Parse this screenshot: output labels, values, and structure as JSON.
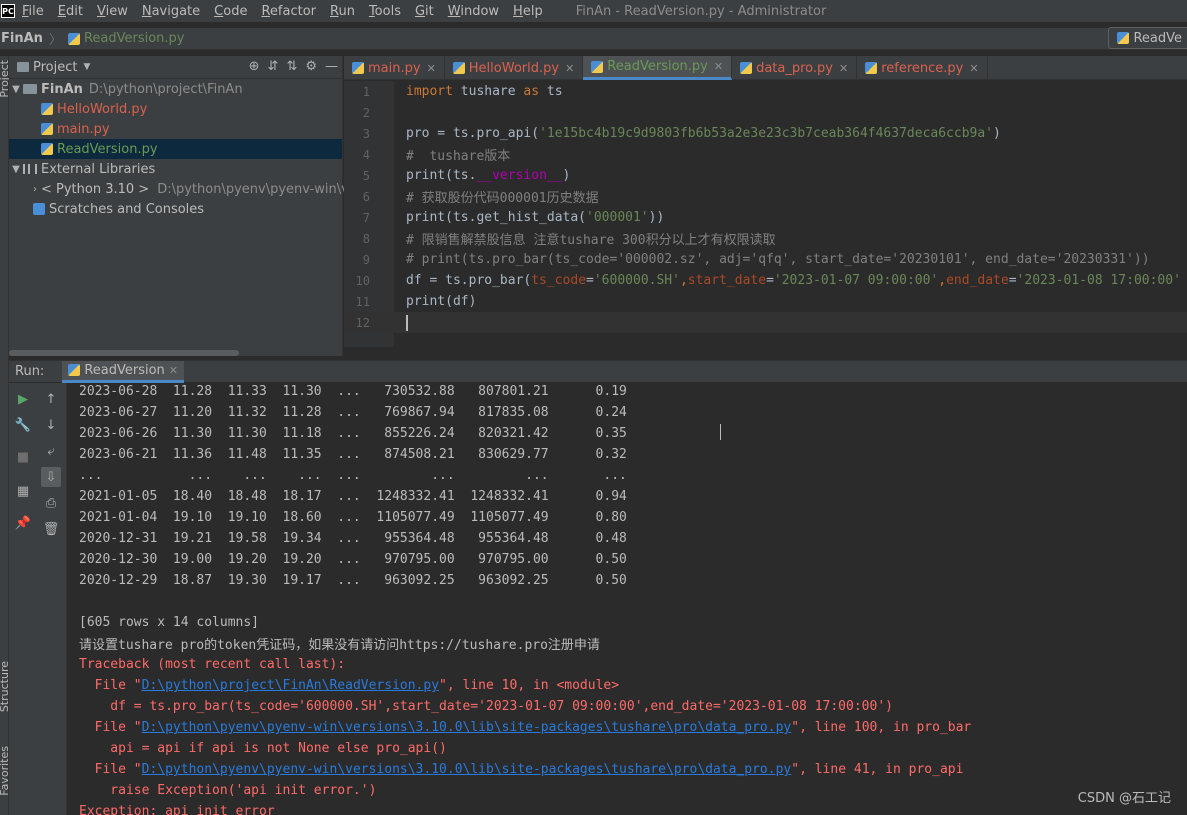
{
  "menubar": {
    "items": [
      "File",
      "Edit",
      "View",
      "Navigate",
      "Code",
      "Refactor",
      "Run",
      "Tools",
      "Git",
      "Window",
      "Help"
    ],
    "window_title": "FinAn - ReadVersion.py - Administrator",
    "logo": "PC"
  },
  "navbar": {
    "project": "FinAn",
    "file": "ReadVersion.py",
    "run_config": "ReadVe"
  },
  "project_panel": {
    "title": "Project",
    "tree": [
      {
        "label": "FinAn",
        "path": "D:\\python\\project\\FinAn"
      },
      {
        "label": "HelloWorld.py"
      },
      {
        "label": "main.py"
      },
      {
        "label": "ReadVersion.py"
      },
      {
        "label": "External Libraries"
      },
      {
        "label": "< Python 3.10 >",
        "path": "D:\\python\\pyenv\\pyenv-win\\ve"
      },
      {
        "label": "Scratches and Consoles"
      }
    ],
    "side_labels": {
      "project": "Project",
      "structure": "Structure",
      "favorites": "Favorites"
    }
  },
  "editor": {
    "tabs": [
      "main.py",
      "HelloWorld.py",
      "ReadVersion.py",
      "data_pro.py",
      "reference.py"
    ],
    "active_tab": "ReadVersion.py",
    "line_numbers": [
      "1",
      "2",
      "3",
      "4",
      "5",
      "6",
      "7",
      "8",
      "9",
      "10",
      "11",
      "12"
    ],
    "lines": {
      "l1a": "import",
      "l1b": " tushare ",
      "l1c": "as",
      "l1d": " ts",
      "l3a": "pro = ts.pro_api(",
      "l3b": "'1e15bc4b19c9d9803fb6b53a2e3e23c3b7ceab364f4637deca6ccb9a'",
      "l3c": ")",
      "l4": "#  tushare版本",
      "l5a": "print(ts.",
      "l5b": "__version__",
      "l5c": ")",
      "l6": "# 获取股份代码000001历史数据",
      "l7a": "print(ts.get_hist_data(",
      "l7b": "'000001'",
      "l7c": "))",
      "l8": "# 限销售解禁股信息 注意tushare 300积分以上才有权限读取",
      "l9": "# print(ts.pro_bar(ts_code='000002.sz', adj='qfq', start_date='20230101', end_date='20230331'))",
      "l10a": "df = ts.pro_bar(",
      "l10b": "ts_code",
      "l10c": "=",
      "l10d": "'600000.SH'",
      "l10e": ",",
      "l10f": "start_date",
      "l10g": "=",
      "l10h": "'2023-01-07 09:00:00'",
      "l10i": ",",
      "l10j": "end_date",
      "l10k": "=",
      "l10l": "'2023-01-08 17:00:00'",
      "l11": "print(df)"
    }
  },
  "run_panel": {
    "label": "Run:",
    "tab": "ReadVersion",
    "table_rows": [
      "2023-06-28  11.28  11.33  11.30  ...   730532.88   807801.21      0.19",
      "2023-06-27  11.20  11.32  11.28  ...   769867.94   817835.08      0.24",
      "2023-06-26  11.30  11.30  11.18  ...   855226.24   820321.42      0.35",
      "2023-06-21  11.36  11.48  11.35  ...   874508.21   830629.77      0.32",
      "...           ...    ...    ...  ...         ...         ...       ...",
      "2021-01-05  18.40  18.48  18.17  ...  1248332.41  1248332.41      0.94",
      "2021-01-04  19.10  19.10  18.60  ...  1105077.49  1105077.49      0.80",
      "2020-12-31  19.21  19.58  19.34  ...   955364.48   955364.48      0.48",
      "2020-12-30  19.00  19.20  19.20  ...   970795.00   970795.00      0.50",
      "2020-12-29  18.87  19.30  19.17  ...   963092.25   963092.25      0.50"
    ],
    "summary": "[605 rows x 14 columns]",
    "token_msg": "请设置tushare pro的token凭证码，如果没有请访问https://tushare.pro注册申请",
    "traceback_title": "Traceback (most recent call last):",
    "tb1_pre": "  File \"",
    "tb1_link": "D:\\python\\project\\FinAn\\ReadVersion.py",
    "tb1_post": "\", line 10, in <module>",
    "tb1_code": "    df = ts.pro_bar(ts_code='600000.SH',start_date='2023-01-07 09:00:00',end_date='2023-01-08 17:00:00')",
    "tb2_pre": "  File \"",
    "tb2_link": "D:\\python\\pyenv\\pyenv-win\\versions\\3.10.0\\lib\\site-packages\\tushare\\pro\\data_pro.py",
    "tb2_post": "\", line 100, in pro_bar",
    "tb2_code": "    api = api if api is not None else pro_api()",
    "tb3_pre": "  File \"",
    "tb3_link": "D:\\python\\pyenv\\pyenv-win\\versions\\3.10.0\\lib\\site-packages\\tushare\\pro\\data_pro.py",
    "tb3_post": "\", line 41, in pro_api",
    "tb3_code": "    raise Exception('api init error.')",
    "exception": "Exception: api init error"
  },
  "watermark": "CSDN @石工记",
  "colors": {
    "accent": "#4a88c7",
    "error": "#ff6b68",
    "link": "#287bde",
    "string": "#6a8759",
    "keyword": "#cc7832"
  }
}
